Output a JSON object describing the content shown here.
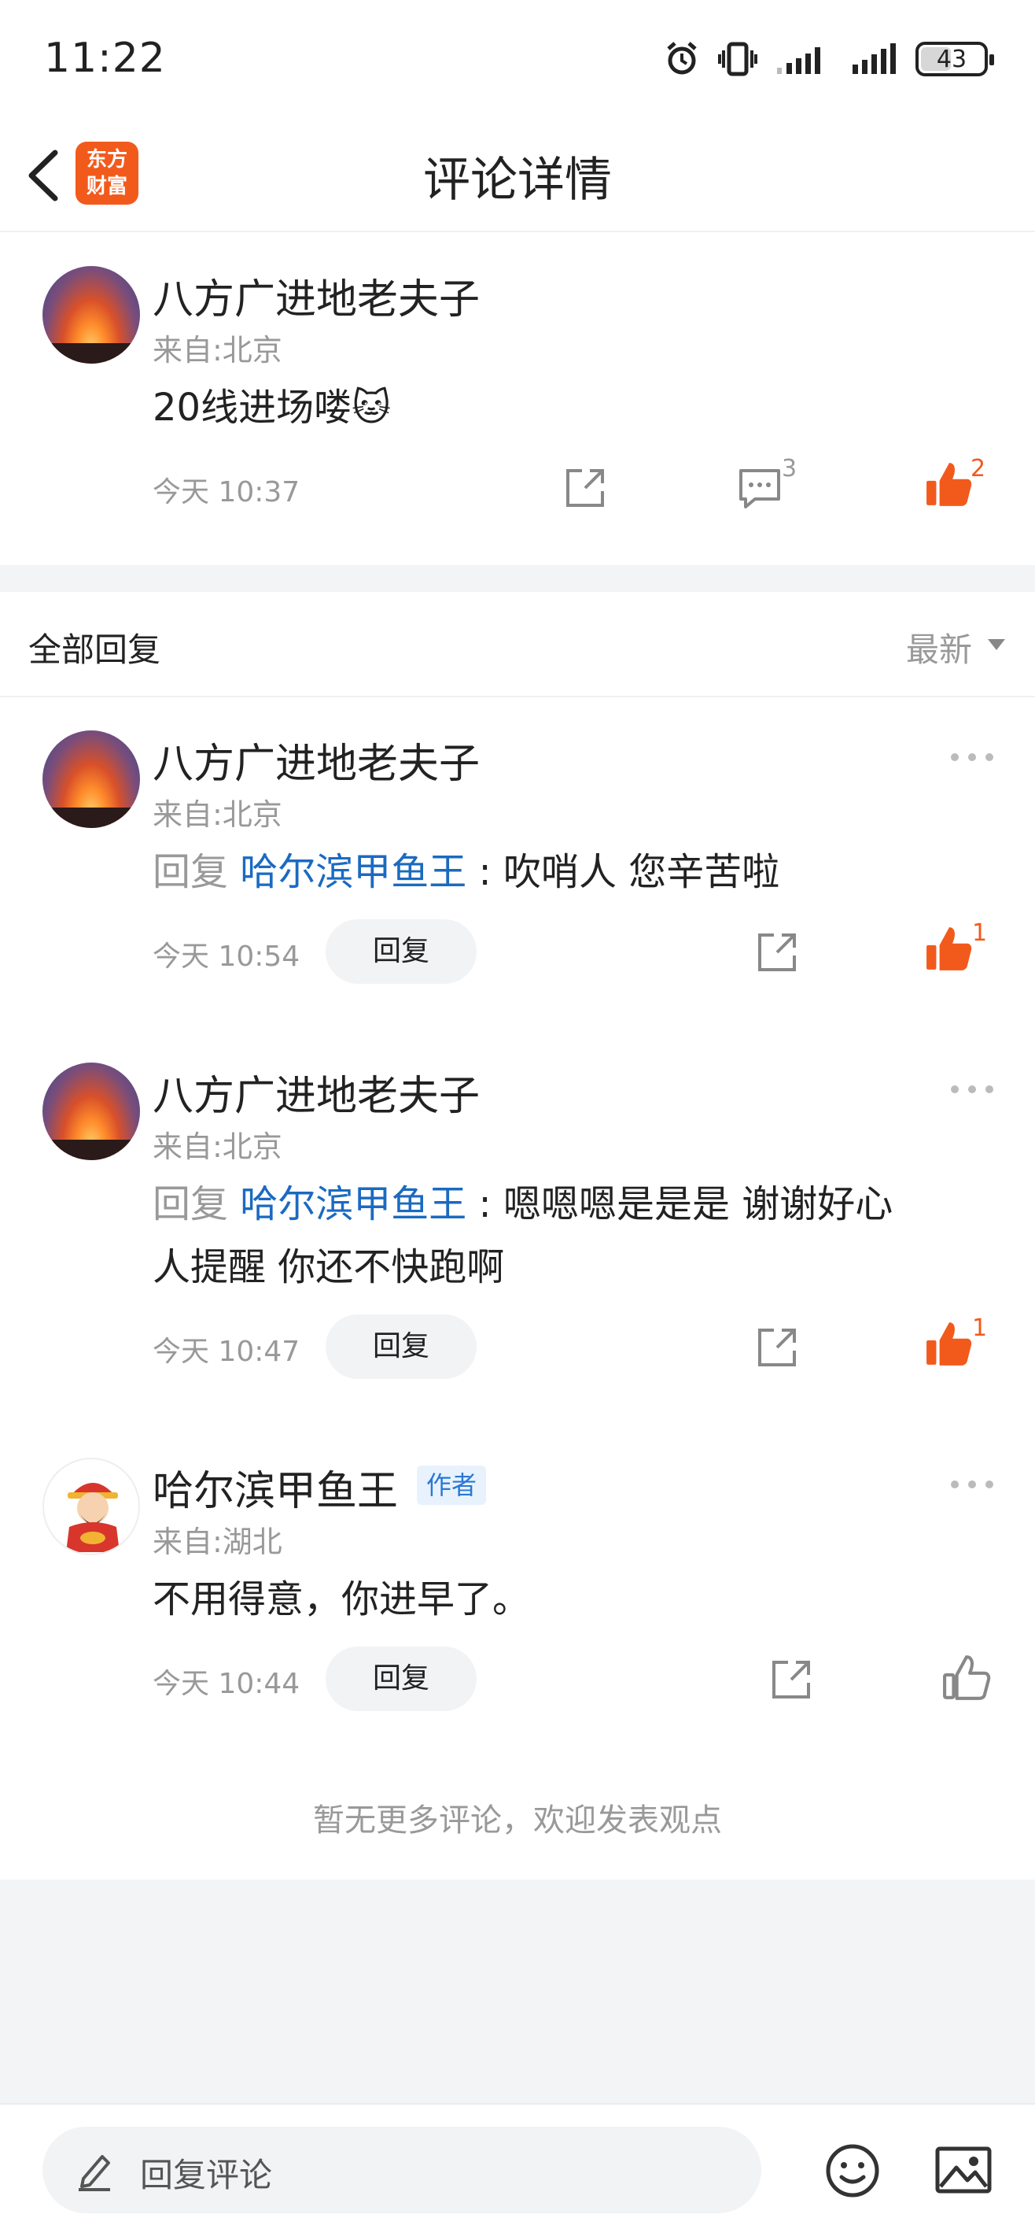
{
  "status_bar": {
    "time": "11:22",
    "battery": "43"
  },
  "nav": {
    "title": "评论详情",
    "logo_line1": "东方",
    "logo_line2": "财富"
  },
  "main_comment": {
    "name": "八方广进地老夫子",
    "location": "来自:北京",
    "text": "20线进场喽🐱",
    "time": "今天 10:37",
    "comment_count": "3",
    "like_count": "2"
  },
  "replies_header": {
    "title": "全部回复",
    "sort": "最新"
  },
  "replies": [
    {
      "name": "八方广进地老夫子",
      "location": "来自:北京",
      "prefix": "回复 ",
      "target": "哈尔滨甲鱼王",
      "text": " : 吹哨人 您辛苦啦",
      "time": "今天 10:54",
      "reply_label": "回复",
      "like_count": "1"
    },
    {
      "name": "八方广进地老夫子",
      "location": "来自:北京",
      "prefix": "回复 ",
      "target": "哈尔滨甲鱼王",
      "text_line1": " : 嗯嗯嗯是是是 谢谢好心",
      "text_line2": "人提醒 你还不快跑啊",
      "time": "今天 10:47",
      "reply_label": "回复",
      "like_count": "1"
    },
    {
      "name": "哈尔滨甲鱼王",
      "badge": "作者",
      "location": "来自:湖北",
      "text": "不用得意，你进早了。",
      "time": "今天 10:44",
      "reply_label": "回复"
    }
  ],
  "footer_note": "暂无更多评论，欢迎发表观点",
  "bottom_bar": {
    "placeholder": "回复评论"
  },
  "colors": {
    "accent": "#f25a1c",
    "link": "#1b6ac0",
    "muted": "#999999"
  }
}
